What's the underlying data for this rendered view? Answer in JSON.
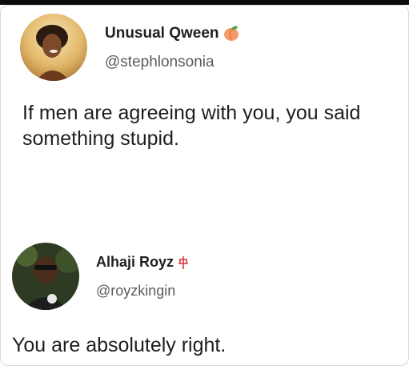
{
  "tweet": {
    "author_name": "Unusual Qween",
    "author_handle": "@stephlonsonia",
    "name_emoji": "peach-emoji",
    "text": "If men are agreeing with you, you said something stupid."
  },
  "reply": {
    "author_name": "Alhaji Royz",
    "author_handle": "@royzkingin",
    "name_emoji": "red-symbol-emoji",
    "text": "You are absolutely right."
  },
  "colors": {
    "name": "#202020",
    "handle": "#5b5b5b",
    "text": "#1e1e1e",
    "border": "#d6d6d6"
  }
}
